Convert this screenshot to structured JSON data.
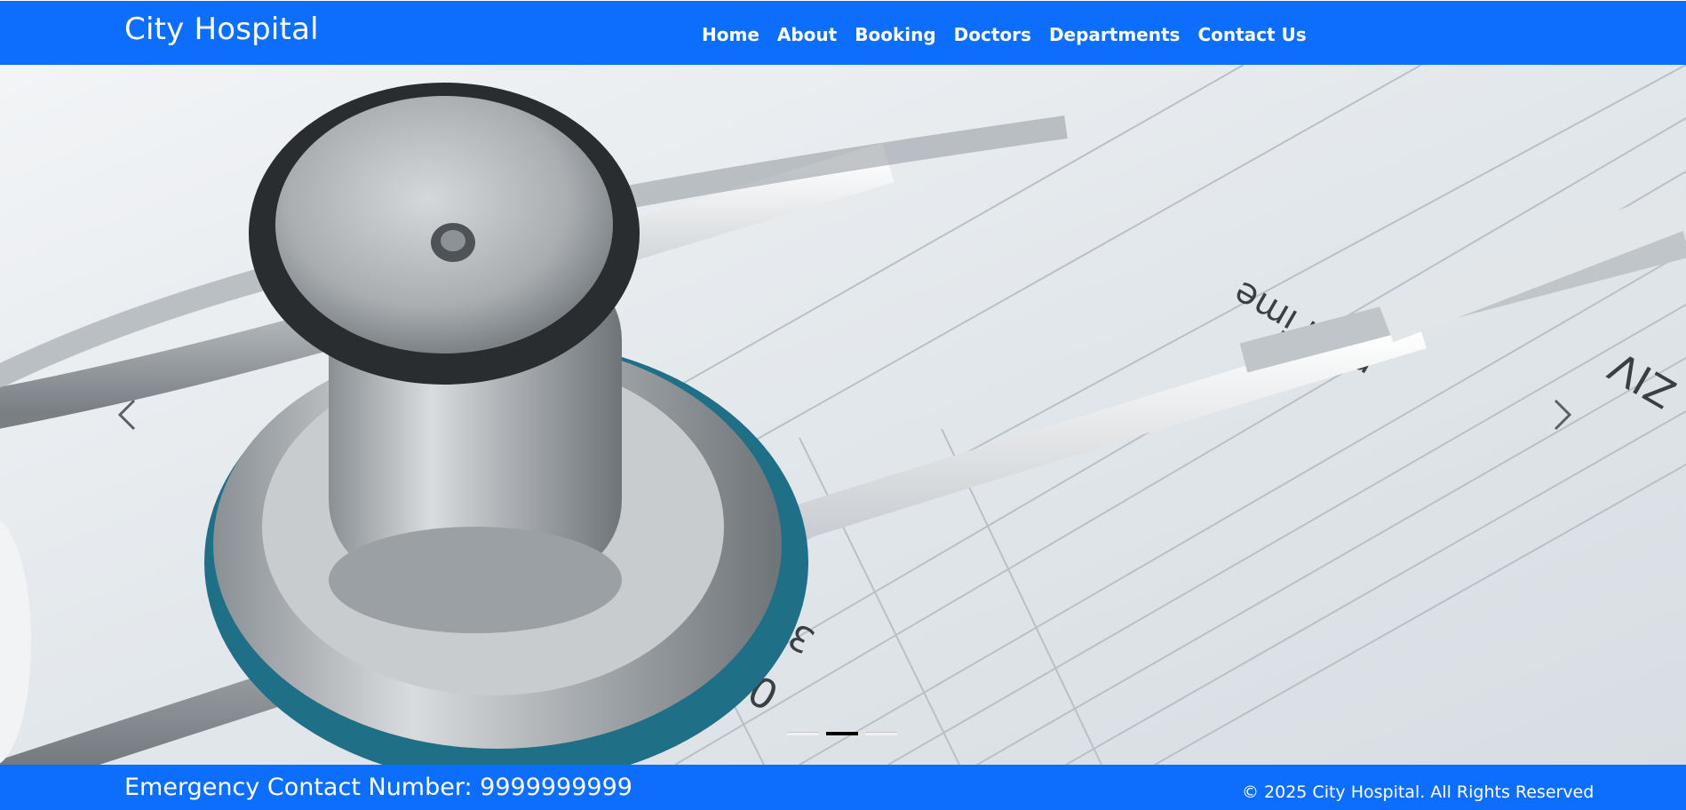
{
  "navbar": {
    "brand": "City Hospital",
    "links": [
      "Home",
      "About",
      "Booking",
      "Doctors",
      "Departments",
      "Contact Us"
    ],
    "background_color": "#0d6efd"
  },
  "carousel": {
    "slide_image": "stethoscope-on-medical-chart",
    "prev_icon": "chevron-left-icon",
    "next_icon": "chevron-right-icon",
    "slide_count": 3,
    "active_slide": 2
  },
  "footer": {
    "emergency": "Emergency Contact Number: 9999999999",
    "copyright": "© 2025 City Hospital. All Rights Reserved",
    "background_color": "#0d6efd"
  }
}
